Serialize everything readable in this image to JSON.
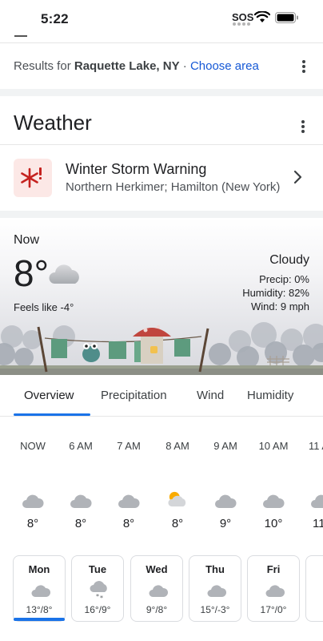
{
  "status_bar": {
    "time": "5:22",
    "sos": "SOS"
  },
  "results": {
    "prefix": "Results for",
    "location": "Raquette Lake, NY",
    "separator": " · ",
    "choose_area": "Choose area"
  },
  "weather": {
    "title": "Weather"
  },
  "warning": {
    "title": "Winter Storm Warning",
    "subtitle": "Northern Herkimer; Hamilton (New York)",
    "icon": "snowflake-alert-icon"
  },
  "current": {
    "now_label": "Now",
    "temp": "8°",
    "feels_like": "Feels like -4°",
    "condition": "Cloudy",
    "precip": "Precip: 0%",
    "humidity": "Humidity: 82%",
    "wind": "Wind: 9 mph",
    "icon": "cloud-icon"
  },
  "tabs": [
    {
      "label": "Overview",
      "active": true
    },
    {
      "label": "Precipitation",
      "active": false
    },
    {
      "label": "Wind",
      "active": false
    },
    {
      "label": "Humidity",
      "active": false
    }
  ],
  "hourly": [
    {
      "time": "NOW",
      "temp": "8°",
      "icon": "cloud-icon"
    },
    {
      "time": "6 AM",
      "temp": "8°",
      "icon": "cloud-icon"
    },
    {
      "time": "7 AM",
      "temp": "8°",
      "icon": "cloud-icon"
    },
    {
      "time": "8 AM",
      "temp": "8°",
      "icon": "partly-cloudy-icon"
    },
    {
      "time": "9 AM",
      "temp": "9°",
      "icon": "cloud-icon"
    },
    {
      "time": "10 AM",
      "temp": "10°",
      "icon": "cloud-icon"
    },
    {
      "time": "11 A",
      "temp": "11",
      "icon": "cloud-icon"
    }
  ],
  "daily": [
    {
      "day": "Mon",
      "range": "13°/8°",
      "icon": "cloud-icon",
      "selected": true
    },
    {
      "day": "Tue",
      "range": "16°/9°",
      "icon": "snow-cloud-icon",
      "selected": false
    },
    {
      "day": "Wed",
      "range": "9°/8°",
      "icon": "cloud-icon",
      "selected": false
    },
    {
      "day": "Thu",
      "range": "15°/-3°",
      "icon": "cloud-icon",
      "selected": false
    },
    {
      "day": "Fri",
      "range": "17°/0°",
      "icon": "cloud-icon",
      "selected": false
    }
  ],
  "colors": {
    "accent": "#1a73e8",
    "link": "#1558d6",
    "warning_bg": "#fce8e6",
    "warning_icon": "#c5221f"
  }
}
